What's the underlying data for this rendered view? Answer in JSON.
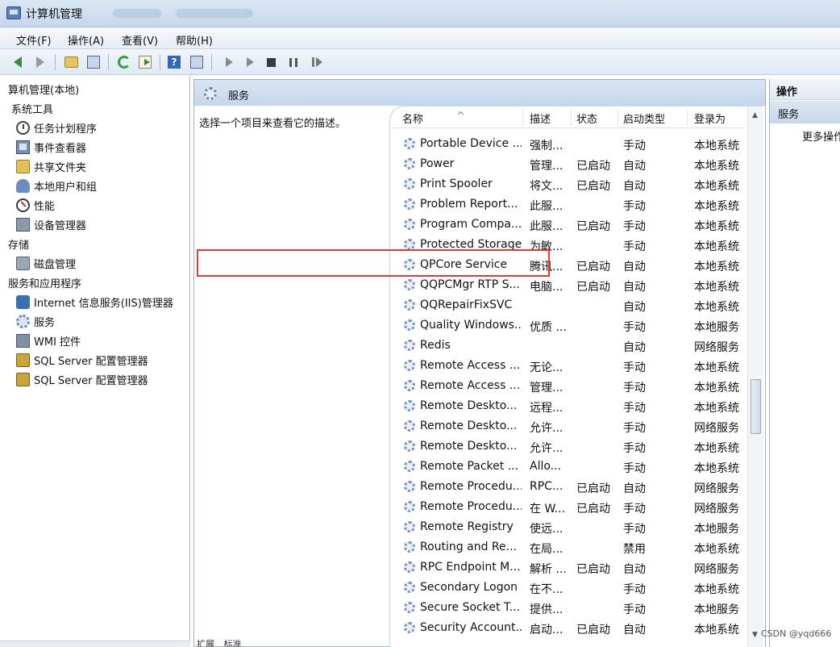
{
  "window": {
    "title": "计算机管理"
  },
  "menu": [
    "文件(F)",
    "操作(A)",
    "查看(V)",
    "帮助(H)"
  ],
  "toolbar": {
    "icons": [
      "back-arrow-icon",
      "forward-arrow-icon",
      "up-folder-icon",
      "show-hide-tree-icon",
      "refresh-icon",
      "export-list-icon",
      "help-icon",
      "properties-icon",
      "start-service-icon",
      "start-service-alt-icon",
      "stop-service-icon",
      "pause-service-icon",
      "restart-service-icon"
    ]
  },
  "tree": {
    "root": "算机管理(本地)",
    "system_tools": "系统工具",
    "task_scheduler": "任务计划程序",
    "event_viewer": "事件查看器",
    "shared_folders": "共享文件夹",
    "local_users": "本地用户和组",
    "performance": "性能",
    "device_manager": "设备管理器",
    "storage": "存储",
    "disk_management": "磁盘管理",
    "services_apps": "服务和应用程序",
    "iis": "Internet 信息服务(IIS)管理器",
    "services": "服务",
    "wmi": "WMI 控件",
    "sql1": "SQL Server 配置管理器",
    "sql2": "SQL Server 配置管理器"
  },
  "center": {
    "header": "服务",
    "description": "选择一个项目来查看它的描述。",
    "columns": {
      "name": "名称",
      "desc": "描述",
      "status": "状态",
      "startup": "启动类型",
      "logon": "登录为"
    },
    "sort_indicator": "^",
    "rows": [
      {
        "name": "Portable Device ...",
        "desc": "强制...",
        "status": "",
        "startup": "手动",
        "logon": "本地系统"
      },
      {
        "name": "Power",
        "desc": "管理...",
        "status": "已启动",
        "startup": "自动",
        "logon": "本地系统"
      },
      {
        "name": "Print Spooler",
        "desc": "将文...",
        "status": "已启动",
        "startup": "自动",
        "logon": "本地系统"
      },
      {
        "name": "Problem Report...",
        "desc": "此服...",
        "status": "",
        "startup": "手动",
        "logon": "本地系统"
      },
      {
        "name": "Program Compa...",
        "desc": "此服...",
        "status": "已启动",
        "startup": "手动",
        "logon": "本地系统"
      },
      {
        "name": "Protected Storage",
        "desc": "为敏...",
        "status": "",
        "startup": "手动",
        "logon": "本地系统"
      },
      {
        "name": "QPCore Service",
        "desc": "腾讯...",
        "status": "已启动",
        "startup": "自动",
        "logon": "本地系统"
      },
      {
        "name": "QQPCMgr RTP S...",
        "desc": "电脑...",
        "status": "已启动",
        "startup": "自动",
        "logon": "本地系统"
      },
      {
        "name": "QQRepairFixSVC",
        "desc": "",
        "status": "",
        "startup": "自动",
        "logon": "本地系统"
      },
      {
        "name": "Quality Windows...",
        "desc": "优质 ...",
        "status": "",
        "startup": "手动",
        "logon": "本地服务"
      },
      {
        "name": "Redis",
        "desc": "",
        "status": "",
        "startup": "自动",
        "logon": "网络服务"
      },
      {
        "name": "Remote Access ...",
        "desc": "无论...",
        "status": "",
        "startup": "手动",
        "logon": "本地系统"
      },
      {
        "name": "Remote Access ...",
        "desc": "管理...",
        "status": "",
        "startup": "手动",
        "logon": "本地系统"
      },
      {
        "name": "Remote Deskto...",
        "desc": "远程...",
        "status": "",
        "startup": "手动",
        "logon": "本地系统"
      },
      {
        "name": "Remote Deskto...",
        "desc": "允许...",
        "status": "",
        "startup": "手动",
        "logon": "网络服务"
      },
      {
        "name": "Remote Deskto...",
        "desc": "允许...",
        "status": "",
        "startup": "手动",
        "logon": "本地系统"
      },
      {
        "name": "Remote Packet ...",
        "desc": "Allo...",
        "status": "",
        "startup": "手动",
        "logon": "本地系统"
      },
      {
        "name": "Remote Procedu...",
        "desc": "RPC...",
        "status": "已启动",
        "startup": "自动",
        "logon": "网络服务"
      },
      {
        "name": "Remote Procedu...",
        "desc": "在 W...",
        "status": "已启动",
        "startup": "手动",
        "logon": "网络服务"
      },
      {
        "name": "Remote Registry",
        "desc": "使远...",
        "status": "",
        "startup": "手动",
        "logon": "本地服务"
      },
      {
        "name": "Routing and Re...",
        "desc": "在局...",
        "status": "",
        "startup": "禁用",
        "logon": "本地系统"
      },
      {
        "name": "RPC Endpoint M...",
        "desc": "解析 ...",
        "status": "已启动",
        "startup": "自动",
        "logon": "网络服务"
      },
      {
        "name": "Secondary Logon",
        "desc": "在不...",
        "status": "",
        "startup": "手动",
        "logon": "本地系统"
      },
      {
        "name": "Secure Socket T...",
        "desc": "提供...",
        "status": "",
        "startup": "手动",
        "logon": "本地服务"
      },
      {
        "name": "Security Account...",
        "desc": "启动...",
        "status": "已启动",
        "startup": "自动",
        "logon": "本地系统"
      }
    ],
    "tabs": [
      "扩展",
      "标准"
    ]
  },
  "actions": {
    "header": "操作",
    "section": "服务",
    "more": "更多操作"
  },
  "watermark": "CSDN @yqd666"
}
